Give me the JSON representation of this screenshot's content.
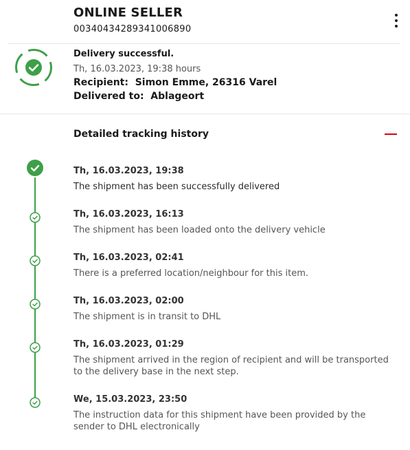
{
  "header": {
    "seller_name": "ONLINE SELLER",
    "tracking_number": "00340434289341006890"
  },
  "status": {
    "title": "Delivery successful.",
    "time": "Th, 16.03.2023, 19:38 hours",
    "recipient_label": "Recipient:",
    "recipient_value": "Simon Emme, 26316 Varel",
    "delivered_to_label": "Delivered to:",
    "delivered_to_value": "Ablageort"
  },
  "history": {
    "title": "Detailed tracking history",
    "events": [
      {
        "date": "Th, 16.03.2023, 19:38",
        "description": "The shipment has been successfully delivered"
      },
      {
        "date": "Th, 16.03.2023, 16:13",
        "description": "The shipment has been loaded onto the delivery vehicle"
      },
      {
        "date": "Th, 16.03.2023, 02:41",
        "description": "There is a preferred location/neighbour for this item."
      },
      {
        "date": "Th, 16.03.2023, 02:00",
        "description": "The shipment is in transit to DHL"
      },
      {
        "date": "Th, 16.03.2023, 01:29",
        "description": "The shipment arrived in the region of recipient and will be transported to the delivery base in the next step."
      },
      {
        "date": "We, 15.03.2023, 23:50",
        "description": "The instruction data for this shipment have been provided by the sender to DHL electronically"
      }
    ]
  },
  "icons": {
    "status": "check-circle-ring-icon",
    "timeline_step": "check-circle-icon",
    "menu": "kebab-menu-icon",
    "collapse": "minus-icon"
  },
  "colors": {
    "success_green": "#3da047",
    "accent_red": "#d40511"
  }
}
